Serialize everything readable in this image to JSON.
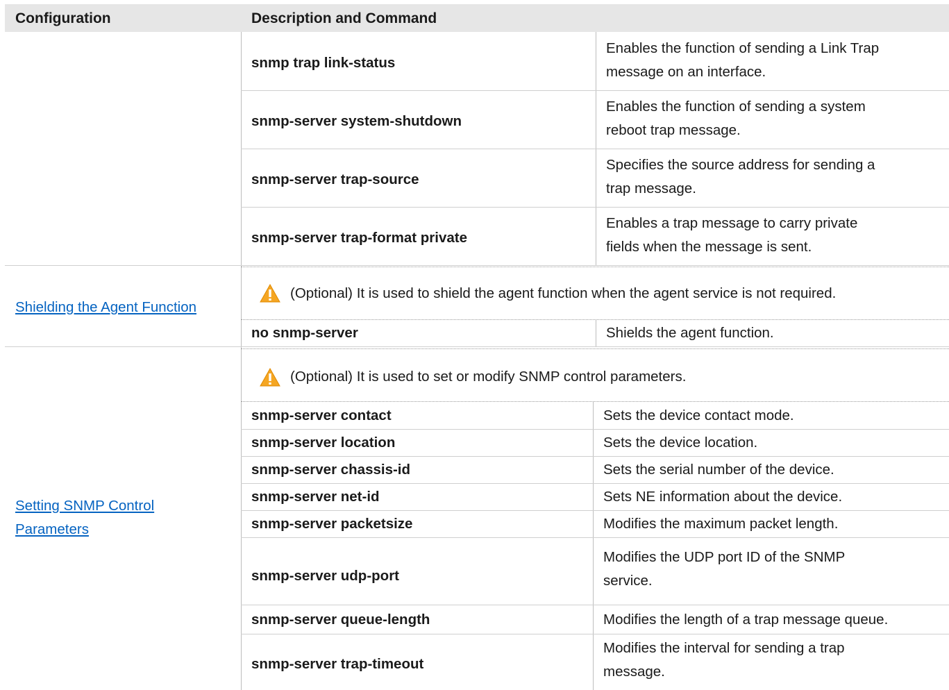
{
  "header": {
    "configuration": "Configuration",
    "description": "Description and Command"
  },
  "trap_rows": [
    {
      "command": "snmp trap link-status",
      "desc1": "Enables the function of sending a Link Trap",
      "desc2": "message on an interface."
    },
    {
      "command": "snmp-server system-shutdown",
      "desc1": "Enables the function of sending a system",
      "desc2": "reboot trap message."
    },
    {
      "command": "snmp-server trap-source",
      "desc1": "Specifies the source address for sending a",
      "desc2": "trap message."
    },
    {
      "command": "snmp-server trap-format private",
      "desc1": "Enables a trap message to carry private",
      "desc2": "fields when the message is sent."
    }
  ],
  "shield": {
    "link": "Shielding the Agent Function",
    "note": "(Optional) It is used to shield the agent function when the agent service is not required.",
    "command": "no snmp-server",
    "description": "Shields the agent function."
  },
  "control": {
    "link_line1": "Setting SNMP Control ",
    "link_line2": "Parameters",
    "note": "(Optional) It is used to set or modify SNMP control parameters.",
    "rows": [
      {
        "command": "snmp-server contact",
        "desc1": "Sets the device contact mode."
      },
      {
        "command": "snmp-server location",
        "desc1": "Sets the device location."
      },
      {
        "command": "snmp-server chassis-id",
        "desc1": "Sets the serial number of the device."
      },
      {
        "command": "snmp-server net-id",
        "desc1": "Sets NE information about the device."
      },
      {
        "command": "snmp-server packetsize",
        "desc1": "Modifies the maximum packet length."
      },
      {
        "command": "snmp-server udp-port",
        "desc1": "Modifies the UDP port ID of the SNMP",
        "desc2": "service."
      },
      {
        "command": "snmp-server queue-length",
        "desc1": "Modifies the length of a trap message queue."
      },
      {
        "command": "snmp-server trap-timeout",
        "desc1": "Modifies the interval for sending a trap",
        "desc2": "message."
      }
    ]
  },
  "colors": {
    "header_bg": "#e6e6e6",
    "link": "#0563c1",
    "warning": "#f5a623"
  },
  "icons": {
    "warning": "warning-icon"
  }
}
